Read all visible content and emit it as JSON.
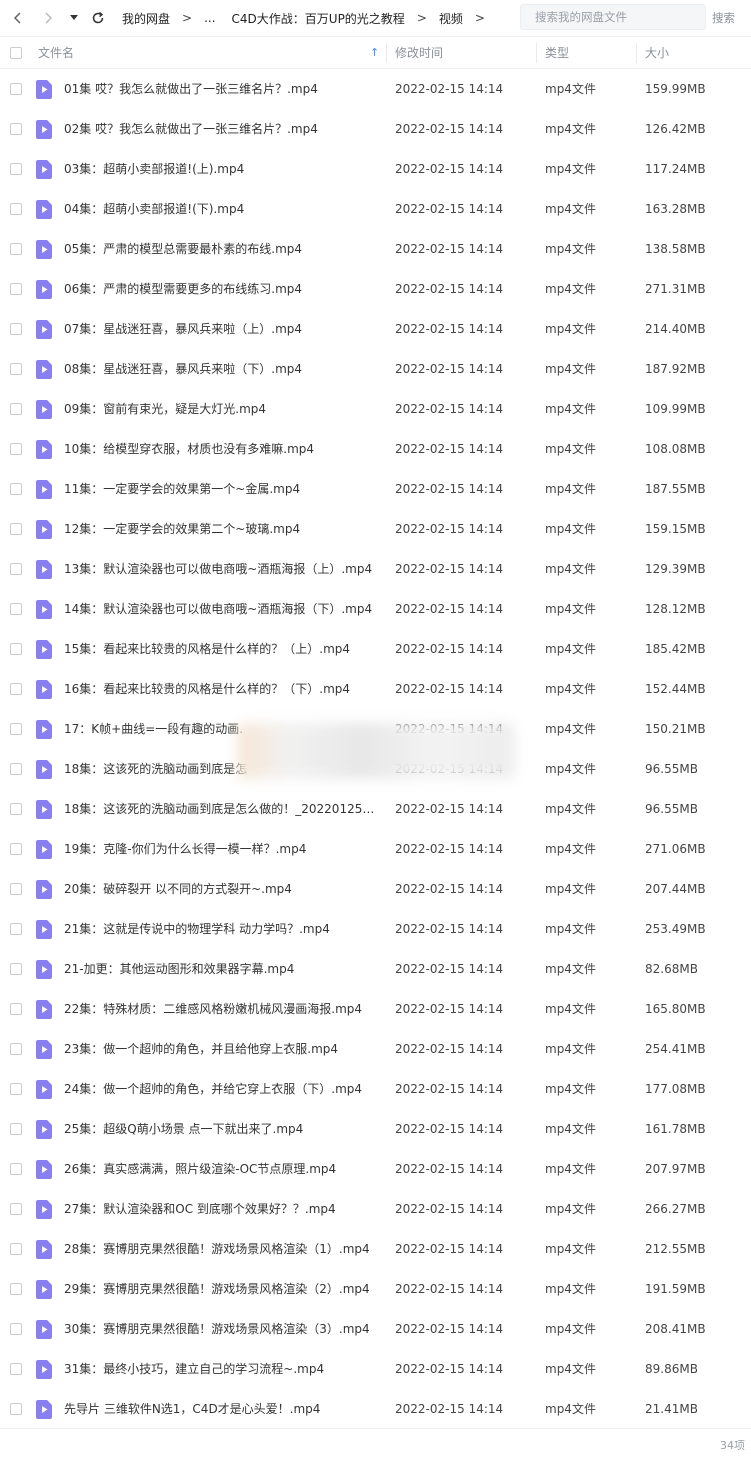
{
  "toolbar": {
    "breadcrumbs": [
      "我的网盘",
      "...",
      "C4D大作战：百万UP的光之教程",
      "视频"
    ],
    "search_placeholder": "搜索我的网盘文件",
    "search_button": "搜索"
  },
  "header": {
    "name": "文件名",
    "time": "修改时间",
    "type": "类型",
    "size": "大小"
  },
  "files": [
    {
      "name": "01集 哎？我怎么就做出了一张三维名片？.mp4",
      "time": "2022-02-15 14:14",
      "type": "mp4文件",
      "size": "159.99MB"
    },
    {
      "name": "02集 哎？我怎么就做出了一张三维名片？.mp4",
      "time": "2022-02-15 14:14",
      "type": "mp4文件",
      "size": "126.42MB"
    },
    {
      "name": "03集：超萌小卖部报道!(上).mp4",
      "time": "2022-02-15 14:14",
      "type": "mp4文件",
      "size": "117.24MB"
    },
    {
      "name": "04集：超萌小卖部报道!(下).mp4",
      "time": "2022-02-15 14:14",
      "type": "mp4文件",
      "size": "163.28MB"
    },
    {
      "name": "05集：严肃的模型总需要最朴素的布线.mp4",
      "time": "2022-02-15 14:14",
      "type": "mp4文件",
      "size": "138.58MB"
    },
    {
      "name": "06集：严肃的模型需要更多的布线练习.mp4",
      "time": "2022-02-15 14:14",
      "type": "mp4文件",
      "size": "271.31MB"
    },
    {
      "name": "07集：星战迷狂喜，暴风兵来啦（上）.mp4",
      "time": "2022-02-15 14:14",
      "type": "mp4文件",
      "size": "214.40MB"
    },
    {
      "name": "08集：星战迷狂喜，暴风兵来啦（下）.mp4",
      "time": "2022-02-15 14:14",
      "type": "mp4文件",
      "size": "187.92MB"
    },
    {
      "name": "09集：窗前有束光，疑是大灯光.mp4",
      "time": "2022-02-15 14:14",
      "type": "mp4文件",
      "size": "109.99MB"
    },
    {
      "name": "10集：给模型穿衣服，材质也没有多难嘛.mp4",
      "time": "2022-02-15 14:14",
      "type": "mp4文件",
      "size": "108.08MB"
    },
    {
      "name": "11集：一定要学会的效果第一个~金属.mp4",
      "time": "2022-02-15 14:14",
      "type": "mp4文件",
      "size": "187.55MB"
    },
    {
      "name": "12集：一定要学会的效果第二个~玻璃.mp4",
      "time": "2022-02-15 14:14",
      "type": "mp4文件",
      "size": "159.15MB"
    },
    {
      "name": "13集：默认渲染器也可以做电商哦~酒瓶海报（上）.mp4",
      "time": "2022-02-15 14:14",
      "type": "mp4文件",
      "size": "129.39MB"
    },
    {
      "name": "14集：默认渲染器也可以做电商哦~酒瓶海报（下）.mp4",
      "time": "2022-02-15 14:14",
      "type": "mp4文件",
      "size": "128.12MB"
    },
    {
      "name": "15集：看起来比较贵的风格是什么样的？（上）.mp4",
      "time": "2022-02-15 14:14",
      "type": "mp4文件",
      "size": "185.42MB"
    },
    {
      "name": "16集：看起来比较贵的风格是什么样的？（下）.mp4",
      "time": "2022-02-15 14:14",
      "type": "mp4文件",
      "size": "152.44MB"
    },
    {
      "name": "17：K帧+曲线=一段有趣的动画.",
      "time": "2022-02-15 14:14",
      "type": "mp4文件",
      "size": "150.21MB"
    },
    {
      "name": "18集：这该死的洗脑动画到底是怎",
      "time": "2022-02-15 14:14",
      "type": "mp4文件",
      "size": "96.55MB"
    },
    {
      "name": "18集：这该死的洗脑动画到底是怎么做的！_20220125_1...",
      "time": "2022-02-15 14:14",
      "type": "mp4文件",
      "size": "96.55MB"
    },
    {
      "name": "19集：克隆-你们为什么长得一模一样？.mp4",
      "time": "2022-02-15 14:14",
      "type": "mp4文件",
      "size": "271.06MB"
    },
    {
      "name": "20集：破碎裂开 以不同的方式裂开~.mp4",
      "time": "2022-02-15 14:14",
      "type": "mp4文件",
      "size": "207.44MB"
    },
    {
      "name": "21集：这就是传说中的物理学科 动力学吗？.mp4",
      "time": "2022-02-15 14:14",
      "type": "mp4文件",
      "size": "253.49MB"
    },
    {
      "name": "21-加更：其他运动图形和效果器字幕.mp4",
      "time": "2022-02-15 14:14",
      "type": "mp4文件",
      "size": "82.68MB"
    },
    {
      "name": "22集：特殊材质：二维感风格粉嫩机械风漫画海报.mp4",
      "time": "2022-02-15 14:14",
      "type": "mp4文件",
      "size": "165.80MB"
    },
    {
      "name": "23集：做一个超帅的角色，并且给他穿上衣服.mp4",
      "time": "2022-02-15 14:14",
      "type": "mp4文件",
      "size": "254.41MB"
    },
    {
      "name": "24集：做一个超帅的角色，并给它穿上衣服（下）.mp4",
      "time": "2022-02-15 14:14",
      "type": "mp4文件",
      "size": "177.08MB"
    },
    {
      "name": "25集：超级Q萌小场景 点一下就出来了.mp4",
      "time": "2022-02-15 14:14",
      "type": "mp4文件",
      "size": "161.78MB"
    },
    {
      "name": "26集：真实感满满，照片级渲染-OC节点原理.mp4",
      "time": "2022-02-15 14:14",
      "type": "mp4文件",
      "size": "207.97MB"
    },
    {
      "name": "27集：默认渲染器和OC  到底哪个效果好？？.mp4",
      "time": "2022-02-15 14:14",
      "type": "mp4文件",
      "size": "266.27MB"
    },
    {
      "name": "28集：赛博朋克果然很酷！游戏场景风格渲染（1）.mp4",
      "time": "2022-02-15 14:14",
      "type": "mp4文件",
      "size": "212.55MB"
    },
    {
      "name": "29集：赛博朋克果然很酷！游戏场景风格渲染（2）.mp4",
      "time": "2022-02-15 14:14",
      "type": "mp4文件",
      "size": "191.59MB"
    },
    {
      "name": "30集：赛博朋克果然很酷！游戏场景风格渲染（3）.mp4",
      "time": "2022-02-15 14:14",
      "type": "mp4文件",
      "size": "208.41MB"
    },
    {
      "name": "31集：最终小技巧，建立自己的学习流程~.mp4",
      "time": "2022-02-15 14:14",
      "type": "mp4文件",
      "size": "89.86MB"
    },
    {
      "name": "先导片 三维软件N选1，C4D才是心头爱！.mp4",
      "time": "2022-02-15 14:14",
      "type": "mp4文件",
      "size": "21.41MB"
    }
  ],
  "footer": {
    "count": "34项"
  },
  "colors": {
    "accent": "#3d8bf5",
    "file_icon": "#8a7ff0"
  }
}
